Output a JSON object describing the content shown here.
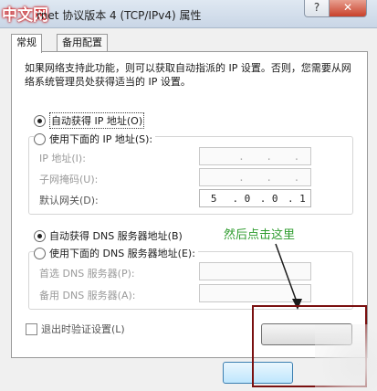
{
  "window": {
    "watermark": "中文网",
    "title": "rnet 协议版本 4 (TCP/IPv4) 属性",
    "help_glyph": "?",
    "close_glyph": "✕"
  },
  "tabs": [
    {
      "label": "常规"
    },
    {
      "label": "备用配置"
    }
  ],
  "description": "如果网络支持此功能，则可以获取自动指派的 IP 设置。否则，您需要从网络系统管理员处获得适当的 IP 设置。",
  "ip_section": {
    "auto_label": "自动获得 IP 地址(O)",
    "manual_label": "使用下面的 IP 地址(S):",
    "fields": [
      {
        "label": "IP 地址(I):",
        "octets": [
          "",
          ".",
          ".",
          "."
        ]
      },
      {
        "label": "子网掩码(U):",
        "octets": [
          "",
          ".",
          ".",
          "."
        ]
      },
      {
        "label": "默认网关(D):",
        "octets": [
          "5",
          ".  0",
          ".  0",
          ".  1"
        ]
      }
    ]
  },
  "dns_section": {
    "auto_label": "自动获得 DNS 服务器地址(B)",
    "manual_label": "使用下面的 DNS 服务器地址(E):",
    "fields": [
      {
        "label": "首选 DNS 服务器(P):"
      },
      {
        "label": "备用 DNS 服务器(A):"
      }
    ]
  },
  "validate_label": "退出时验证设置(L)",
  "annotation_text": "然后点击这里"
}
